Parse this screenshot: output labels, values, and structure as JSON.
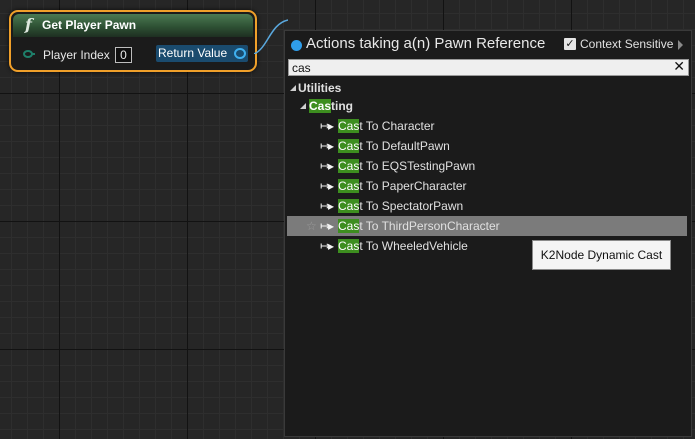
{
  "node": {
    "title": "Get Player Pawn",
    "function_glyph": "f",
    "input_label": "Player Index",
    "input_value": "0",
    "output_label": "Return Value",
    "accent_color": "#f0a02a"
  },
  "menu": {
    "title": "Actions taking a(n) Pawn Reference",
    "context_sensitive_label": "Context Sensitive",
    "context_sensitive_checked": true,
    "search_value": "cas",
    "highlight_color": "#3d8e1f",
    "category": "Utilities",
    "subcategory": {
      "match": "Cas",
      "rest": "ting"
    },
    "items": [
      {
        "match": "Cas",
        "rest": "t To Character",
        "selected": false
      },
      {
        "match": "Cas",
        "rest": "t To DefaultPawn",
        "selected": false
      },
      {
        "match": "Cas",
        "rest": "t To EQSTestingPawn",
        "selected": false
      },
      {
        "match": "Cas",
        "rest": "t To PaperCharacter",
        "selected": false
      },
      {
        "match": "Cas",
        "rest": "t To SpectatorPawn",
        "selected": false
      },
      {
        "match": "Cas",
        "rest": "t To ThirdPersonCharacter",
        "selected": true
      },
      {
        "match": "Cas",
        "rest": "t To WheeledVehicle",
        "selected": false
      }
    ]
  },
  "tooltip": {
    "text": "K2Node Dynamic Cast"
  },
  "icons": {
    "function": "function-icon",
    "input_pin": "exec-pin-icon",
    "output_pin": "object-pin-icon",
    "menu_dot": "blue-circle-icon",
    "clear": "close-icon",
    "cast": "cast-arrow-icon",
    "favorite": "star-icon",
    "expander": "expanded-triangle-icon"
  }
}
